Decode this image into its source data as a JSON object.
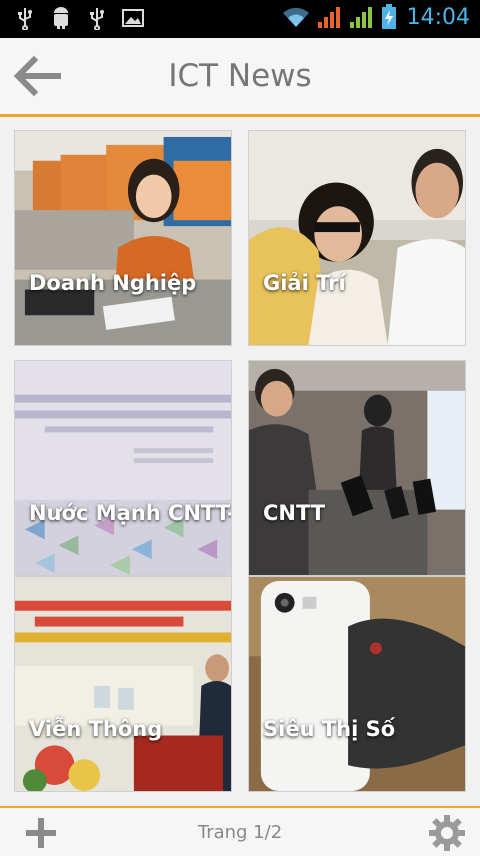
{
  "status_bar": {
    "time": "14:04",
    "left_icons": [
      "usb-icon",
      "android-debug-icon",
      "usb-icon",
      "image-icon"
    ],
    "right_icons": [
      "wifi-icon",
      "signal-orange-icon",
      "signal-green-icon",
      "battery-charging-icon"
    ]
  },
  "header": {
    "title": "ICT News",
    "back_icon": "arrow-left-icon"
  },
  "categories": [
    {
      "label": "Doanh Nghiệp"
    },
    {
      "label": "Giải Trí"
    },
    {
      "label": "Nước Mạnh CNTT-TT"
    },
    {
      "label": "CNTT"
    },
    {
      "label": "Viễn Thông"
    },
    {
      "label": "Siêu Thị Số"
    }
  ],
  "footer": {
    "page_label": "Trang 1/2",
    "add_icon": "plus-icon",
    "settings_icon": "gear-icon"
  },
  "colors": {
    "accent": "#f0a42a",
    "time": "#4fb3e8",
    "title": "#767676"
  }
}
